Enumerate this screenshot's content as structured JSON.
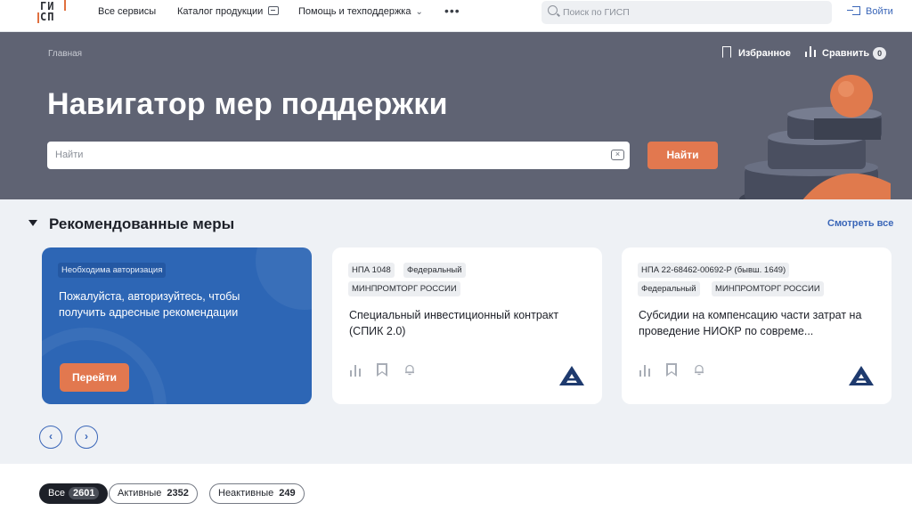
{
  "topbar": {
    "logo_text_line1": "ГИ",
    "logo_text_line2": "СП",
    "nav": [
      "Все сервисы",
      "Каталог продукции",
      "Помощь и техподдержка"
    ],
    "more": "•••",
    "search_placeholder": "Поиск по ГИСП",
    "login": "Войти"
  },
  "hero": {
    "breadcrumb": "Главная",
    "title": "Навигатор мер поддержки",
    "favorites": "Избранное",
    "compare": "Сравнить",
    "compare_count": "0",
    "search_placeholder": "Найти",
    "search_button": "Найти"
  },
  "recommended": {
    "title": "Рекомендованные меры",
    "see_all": "Смотреть все",
    "auth_card": {
      "tag": "Необходима авторизация",
      "text": "Пожалуйста, авторизуйтесь, чтобы получить адресные рекомендации",
      "button": "Перейти"
    },
    "cards": [
      {
        "tags": [
          "НПА 1048",
          "Федеральный",
          "МИНПРОМТОРГ РОССИИ"
        ],
        "title": "Специальный инвестиционный контракт (СПИК 2.0)"
      },
      {
        "tags": [
          "НПА 22-68462-00692-Р (бывш. 1649)",
          "Федеральный",
          "МИНПРОМТОРГ РОССИИ"
        ],
        "title": "Субсидии на компенсацию части затрат на проведение НИОКР по совреме..."
      }
    ],
    "prev": "‹",
    "next": "›"
  },
  "filters": [
    {
      "label": "Все",
      "count": "2601",
      "active": true
    },
    {
      "label": "Активные",
      "count": "2352",
      "active": false
    },
    {
      "label": "Неактивные",
      "count": "249",
      "active": false
    }
  ],
  "colors": {
    "accent_orange": "#e2784f",
    "link_blue": "#3a66b8",
    "hero_bg": "#5f6373",
    "auth_card_bg": "#2d66b5"
  },
  "icons": [
    "search-icon",
    "catalog-icon",
    "chevron-down-icon",
    "login-icon",
    "bookmark-icon",
    "compare-icon",
    "clear-icon",
    "stats-icon",
    "bell-icon",
    "ministry-logo-icon"
  ]
}
